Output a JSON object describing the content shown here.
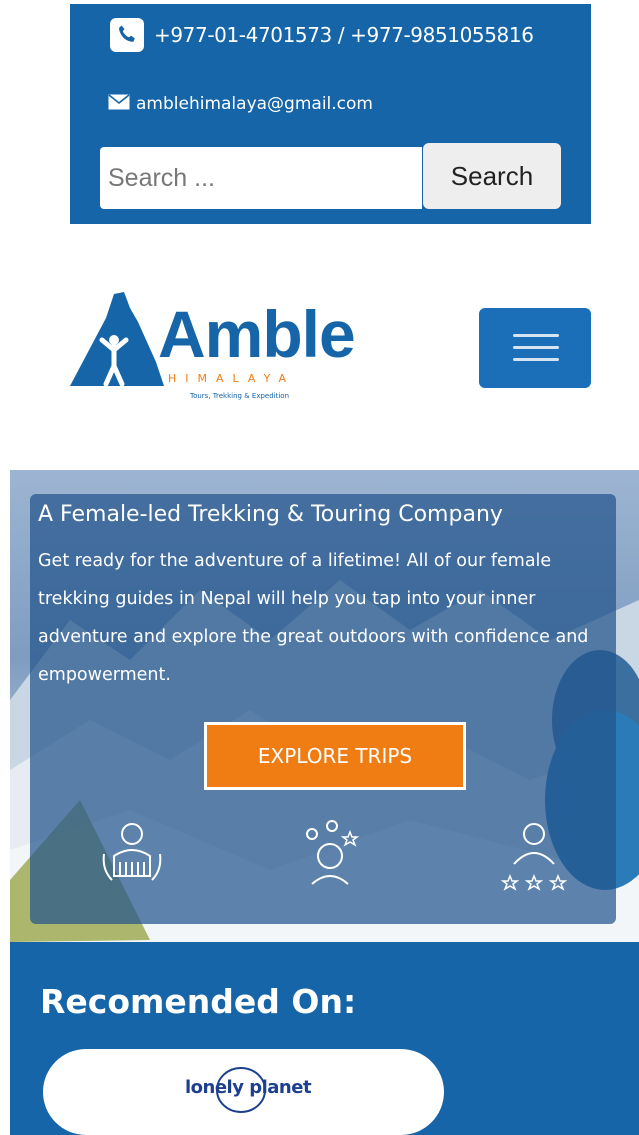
{
  "contact": {
    "phone": "+977-01-4701573 / +977-9851055816",
    "email": "amblehimalaya@gmail.com"
  },
  "search": {
    "placeholder": "Search ...",
    "button_label": "Search"
  },
  "logo": {
    "name": "Amble",
    "subtitle": "HIMALAYA",
    "tagline": "Tours, Trekking & Expedition"
  },
  "hero": {
    "title": "A Female-led Trekking & Touring Company",
    "body": "Get ready for the adventure of a lifetime! All of our female trekking guides in Nepal will help you tap into your inner adventure and explore the great outdoors with confidence and empowerment.",
    "cta": "EXPLORE TRIPS"
  },
  "recommended": {
    "title": "Recomended On:",
    "partner": "lonely planet"
  },
  "colors": {
    "brand_blue": "#1565a8",
    "accent_orange": "#f07d14"
  },
  "icons": [
    "phone-icon",
    "mail-icon",
    "hamburger-menu-icon",
    "female-guide-icon",
    "ideas-icon",
    "rated-guide-icon"
  ]
}
